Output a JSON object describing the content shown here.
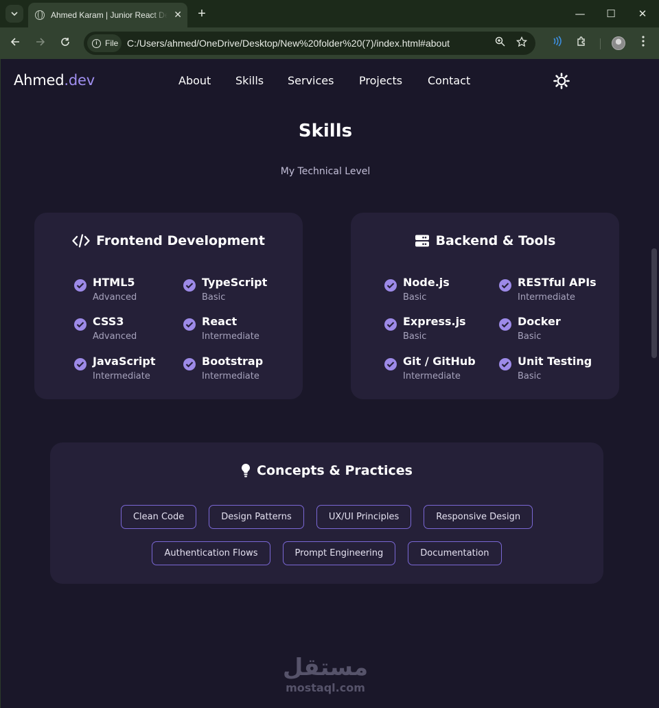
{
  "browser": {
    "tab_title": "Ahmed Karam | Junior React Developer",
    "site_chip": "File",
    "url": "C:/Users/ahmed/OneDrive/Desktop/New%20folder%20(7)/index.html#about",
    "new_tab": "+",
    "minimize": "—",
    "maximize": "☐",
    "close": "✕",
    "tab_close": "✕"
  },
  "site": {
    "logo_main": "Ahmed",
    "logo_accent": ".dev",
    "nav": [
      "About",
      "Skills",
      "Services",
      "Projects",
      "Contact"
    ]
  },
  "skills": {
    "title": "Skills",
    "subtitle": "My Technical Level",
    "frontend": {
      "title": "Frontend Development",
      "items": [
        {
          "name": "HTML5",
          "level": "Advanced"
        },
        {
          "name": "TypeScript",
          "level": "Basic"
        },
        {
          "name": "CSS3",
          "level": "Advanced"
        },
        {
          "name": "React",
          "level": "Intermediate"
        },
        {
          "name": "JavaScript",
          "level": "Intermediate"
        },
        {
          "name": "Bootstrap",
          "level": "Intermediate"
        }
      ]
    },
    "backend": {
      "title": "Backend & Tools",
      "items": [
        {
          "name": "Node.js",
          "level": "Basic"
        },
        {
          "name": "RESTful APIs",
          "level": "Intermediate"
        },
        {
          "name": "Express.js",
          "level": "Basic"
        },
        {
          "name": "Docker",
          "level": "Basic"
        },
        {
          "name": "Git / GitHub",
          "level": "Intermediate"
        },
        {
          "name": "Unit Testing",
          "level": "Basic"
        }
      ]
    },
    "concepts": {
      "title": "Concepts & Practices",
      "chips_row1": [
        "Clean Code",
        "Design Patterns",
        "UX/UI Principles",
        "Responsive Design"
      ],
      "chips_row2": [
        "Authentication Flows",
        "Prompt Engineering",
        "Documentation"
      ]
    }
  },
  "watermark": {
    "arabic": "مستقل",
    "latin": "mostaql.com"
  },
  "colors": {
    "page_bg": "#1a1729",
    "card_bg": "#252038",
    "accent": "#a08ff0",
    "check": "#9d8ae8",
    "chip_border": "#7b68d6"
  }
}
